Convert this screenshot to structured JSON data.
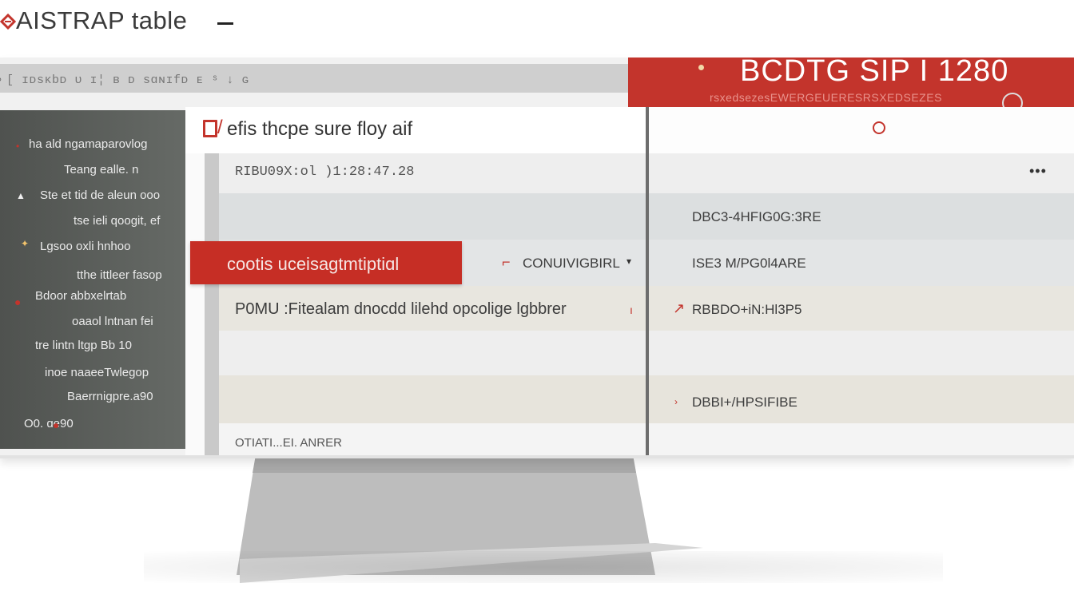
{
  "app": {
    "title": "AISTRAP table"
  },
  "address_bar": {
    "text": "[ ɪᴅsᴋbᴅ ᴜ ɪ¦ ʙ ᴅ sɑɴɪfᴅ ᴇ ˢ ↓ ɢ"
  },
  "banner": {
    "title": "BCDTG SIP I 1280",
    "subtitle": "rsxedsezesEWERGEUERESRSXEDSEZES"
  },
  "sidebar": {
    "items": [
      {
        "label": "ha ald ngamaparovlog"
      },
      {
        "label": "Teang ealle.    n"
      },
      {
        "label": "Ste et tid de aleun ooo"
      },
      {
        "label": "tse ieli qoogit, ef"
      },
      {
        "label": "Lgsoo oxli  hnhoo"
      },
      {
        "label": "tthe ittleer fasop"
      },
      {
        "label": "Bdoor  abbxelrtab"
      },
      {
        "label": "oaaol  lntnan fei"
      },
      {
        "label": "tre lintn ltgp  Bb 10"
      },
      {
        "label": "inoe naaeeTwlegop"
      },
      {
        "label": "Baerrnigpre.a90"
      },
      {
        "label": "O0.  ɑe90"
      }
    ]
  },
  "panel": {
    "heading": "efis thcpe sure floy aif",
    "subheader": "RIBU09X:ol )1:28:47.28",
    "tag_button": "cootis uceisagtmtiptiɑl",
    "rows": [
      {
        "left": "",
        "right": "DBC3-4HFIG0G:3RE"
      },
      {
        "left": "CONUIVIGBIRL",
        "right": "ISE3 M/PG0l4ARE"
      },
      {
        "left": "P0MU :Fitealam dnocdd lilehd opcolige lgbbrer",
        "right": "RBBDO+iN:Hl3P5"
      },
      {
        "left": "",
        "right": ""
      },
      {
        "left": "",
        "right": "DBBI+/HPSIFIBE"
      },
      {
        "left": "OTIATI...EI. ANRER",
        "right": ""
      }
    ],
    "more_label": "•••"
  },
  "colors": {
    "accent": "#c3342c",
    "sidebar": "#575a57",
    "panel": "#fafafa"
  }
}
